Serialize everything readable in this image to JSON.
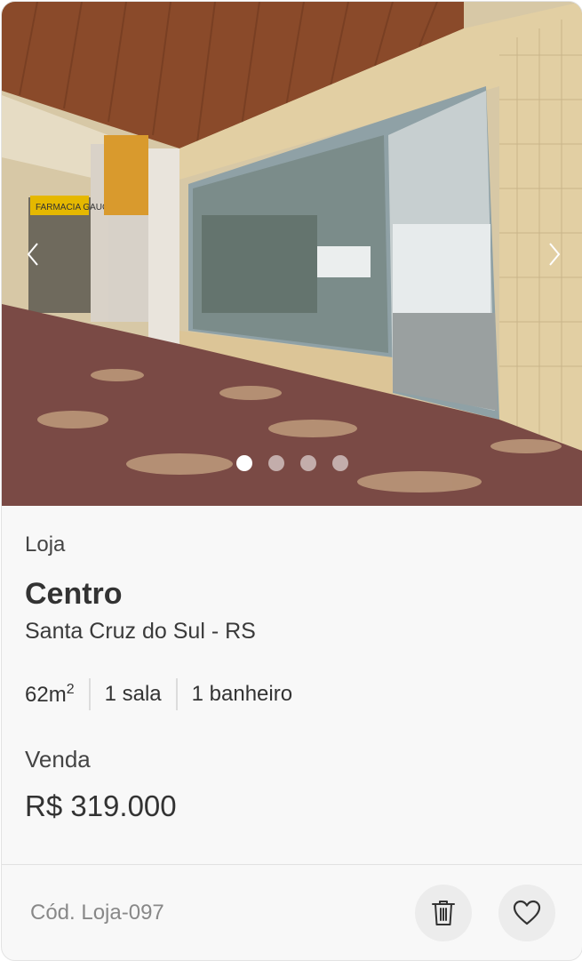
{
  "listing": {
    "type": "Loja",
    "neighborhood": "Centro",
    "city": "Santa Cruz do Sul - RS",
    "area_value": "62m",
    "area_unit_sup": "2",
    "rooms": "1 sala",
    "bathrooms": "1 banheiro",
    "deal": "Venda",
    "price": "R$ 319.000",
    "code": "Cód. Loja-097",
    "sign_text": "FARMACIA GAUCHA"
  },
  "gallery": {
    "image_count": 4,
    "active_index": 0
  },
  "icons": {
    "prev": "chevron-left-icon",
    "next": "chevron-right-icon",
    "delete": "trash-icon",
    "favorite": "heart-icon"
  },
  "colors": {
    "card_bg": "#f8f8f8",
    "text_primary": "#333333",
    "text_muted": "#888888",
    "button_bg": "#ececec"
  }
}
